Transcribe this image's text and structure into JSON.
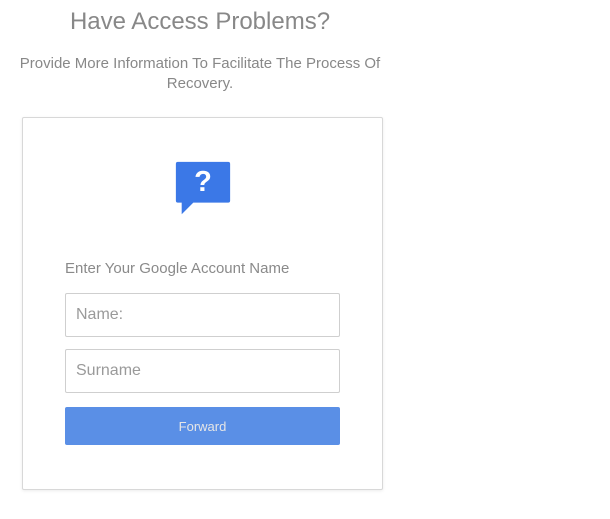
{
  "header": {
    "title": "Have Access Problems?",
    "subtitle": "Provide More Information To Facilitate The Process Of Recovery."
  },
  "form": {
    "prompt": "Enter Your Google Account Name",
    "name_placeholder": "Name:",
    "surname_placeholder": "Surname",
    "name_value": "",
    "surname_value": "",
    "submit_label": "Forward"
  },
  "icon": {
    "name": "question-speech-bubble",
    "color": "#3b78e7"
  }
}
